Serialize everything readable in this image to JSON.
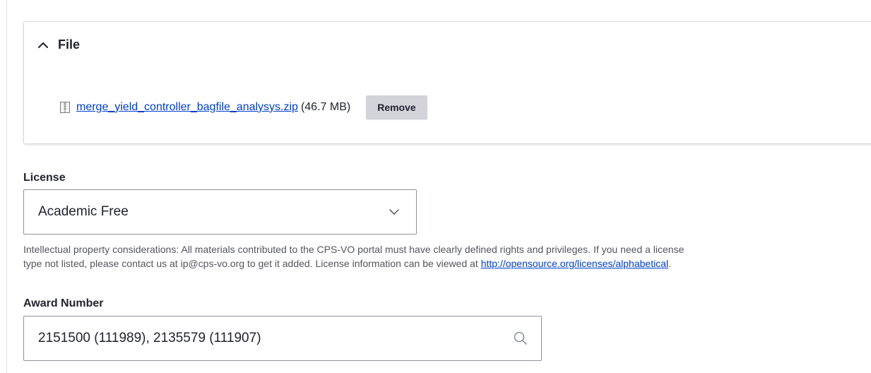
{
  "file_section": {
    "title": "File",
    "file": {
      "name": "merge_yield_controller_bagfile_analysys.zip",
      "size": "(46.7 MB)"
    },
    "remove_label": "Remove",
    "icons": {
      "toggle": "chevron-up-icon",
      "file": "archive-file-icon"
    }
  },
  "license": {
    "label": "License",
    "selected": "Academic Free",
    "description_prefix": "Intellectual property considerations: All materials contributed to the CPS-VO portal must have clearly defined rights and privileges. If you need a license",
    "description_line2": "type not listed, please contact us at ip@cps-vo.org to get it added. License information can be viewed at ",
    "description_link": "http://opensource.org/licenses/alphabetical",
    "description_suffix": ".",
    "icons": {
      "dropdown": "chevron-down-icon"
    }
  },
  "award_number": {
    "label": "Award Number",
    "value": "2151500 (111989), 2135579 (111907)",
    "icons": {
      "search": "search-icon"
    }
  },
  "colors": {
    "link": "#003ecc",
    "button_bg": "#d3d4d9",
    "text": "#222330",
    "muted_text": "#545560",
    "border": "#8e929c"
  }
}
